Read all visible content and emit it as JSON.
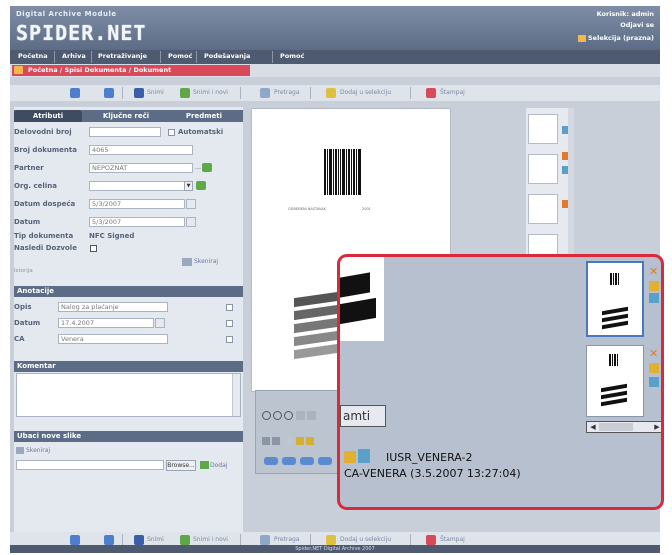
{
  "header": {
    "module_title": "Digital Archive Module",
    "logo": "SPIDER.NET",
    "user_line": "Korisnik: admin",
    "logout": "Odjavi se",
    "selection": "Selekcija (prazna)"
  },
  "menu": [
    "Početna",
    "Arhiva",
    "Pretraživanje",
    "Pomoć",
    "Podešavanja",
    "Pomoć"
  ],
  "breadcrumb": "Početna / Spisi Dokumenta / Dokument",
  "toolbar": {
    "back_label": "",
    "forward_label": "",
    "save_label": "Snimi",
    "save_new_label": "Snimi i novi",
    "search_label": "Pretraga",
    "add_selection_label": "Dodaj u selekciju",
    "print_label": "Štampaj"
  },
  "tabs": [
    {
      "label": "Atributi"
    },
    {
      "label": "Ključne reči"
    },
    {
      "label": "Predmeti"
    }
  ],
  "form": {
    "delovodni_label": "Delovodni broj",
    "delovodni_value": "",
    "automatski_label": "Automatski",
    "broj_label": "Broj dokumenta",
    "broj_value": "4065",
    "partner_label": "Partner",
    "partner_value": "NEPOZNAT",
    "org_label": "Org. celina",
    "org_value": "",
    "dospeca_label": "Datum dospeća",
    "dospeca_value": "5/3/2007",
    "datum_label": "Datum",
    "datum_value": "5/3/2007",
    "tip_label": "Tip dokumenta",
    "tip_value": "NFC Signed",
    "nasledi_label": "Nasledi Dozvole",
    "skeniraj_label": "Skeniraj",
    "istorija_label": "Istorija"
  },
  "anotacije": {
    "title": "Anotacije",
    "opis_label": "Opis",
    "opis_value": "Nalog za plaćanje",
    "datum_label": "Datum",
    "datum_value": "17.4.2007",
    "ca_label": "CA",
    "ca_value": "Venera"
  },
  "komentar": {
    "title": "Komentar",
    "value": ""
  },
  "ubaci": {
    "title": "Ubaci nove slike",
    "skeniraj_label": "Skeniraj",
    "browse_label": "Browse...",
    "dodaj_label": "Dodaj"
  },
  "document": {
    "header_text": "ODREĐENI NASTAVAK",
    "header_year": "2001"
  },
  "overlay": {
    "button_partial": "amti",
    "user": "IUSR_VENERA-2",
    "signer": "CA-VENERA (3.5.2007 13:27:04)"
  },
  "footer": "Spider.NET Digital Archive 2007",
  "colors": {
    "header": "#6f7e98",
    "accent_red": "#d82a3a",
    "breadcrumb": "#d84a5a",
    "panel": "#e4e8ef"
  }
}
